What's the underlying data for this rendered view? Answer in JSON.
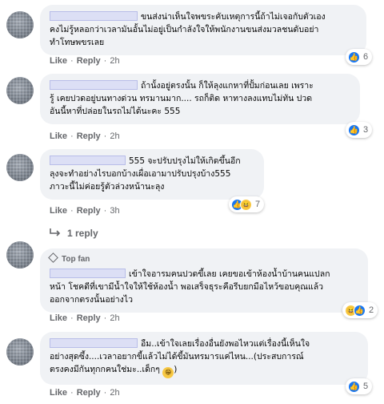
{
  "actions": {
    "like": "Like",
    "reply": "Reply"
  },
  "comments": [
    {
      "lines": [
        "ขนส่งน่าเห็นใจพขระคับเหตุการนี้ถ้าไม่เจอกับตัวเอง",
        "คงไม่รู้หลอกว่าเวลามันอั้นไม่อยู่เป็นกำลังใจให้พนักงานขนส่งมวลชนดับอย่า",
        "ทำโทษพขรเลย"
      ],
      "time": "2h",
      "reaction_count": "6",
      "reaction_icons": [
        "like-icon"
      ]
    },
    {
      "lines": [
        "ถ้านั้งอยู่ตรงนั้น ก็ให้ลุงแกหาที่ปั้มก่อนเลย เพราะ",
        "รู้ เคยปวดอยู่บนทางด่วน ทรมานมาก.... รถก็ติด หาทางลงแทบไม่ทัน ปวด",
        "อันนี้หาที่ปล่อยในรถไม่ได้นะคะ 555"
      ],
      "time": "2h",
      "reaction_count": "3",
      "reaction_icons": [
        "like-icon"
      ]
    },
    {
      "lines": [
        "555 จะปรับปรุงไม่ให้เกิดขึ้นอีก",
        "ลุงจะทำอย่างไรบอกบ้างเผื่อเอามาปรับปรุงบ้าง555",
        "ภาวะนี้ไม่ค่อยรู้ตัวล่วงหน้านะลุง"
      ],
      "time": "3h",
      "reaction_count": "7",
      "reaction_icons": [
        "like-icon",
        "haha-icon"
      ],
      "replies_label": "1 reply"
    },
    {
      "badge": "Top fan",
      "lines": [
        "เข้าใจอารมคนปวดขี้เลย เคยขอเข้าห้องน้ำบ้านคนแปลก",
        "หน้า โชคดีที่เขามีน้ำใจให้ใช้ห้องน้ำ พอเสร็จธุระคือรีบยกมือไหว้ขอบคุณแล้ว",
        "ออกจากตรงนั้นอย่างไว"
      ],
      "time": "2h",
      "reaction_count": "2",
      "reaction_icons": [
        "haha-icon",
        "like-icon"
      ]
    },
    {
      "lines": [
        "อืม..เข้าใจเลยเรื่องอื่นยังพอไหวแต่เรื่องนี้เห็นใจ",
        "อย่างสุดซึ้ง....เวลาอยากขี้แล้วไม่ได้ขี้มันทรมารแค่ไหน...(ประสบการณ์",
        "ตรงคงมีกันทุกกคนใช่มะ..เด็กๆ"
      ],
      "time": "2h",
      "reaction_count": "5",
      "reaction_icons": [
        "like-icon"
      ]
    }
  ]
}
